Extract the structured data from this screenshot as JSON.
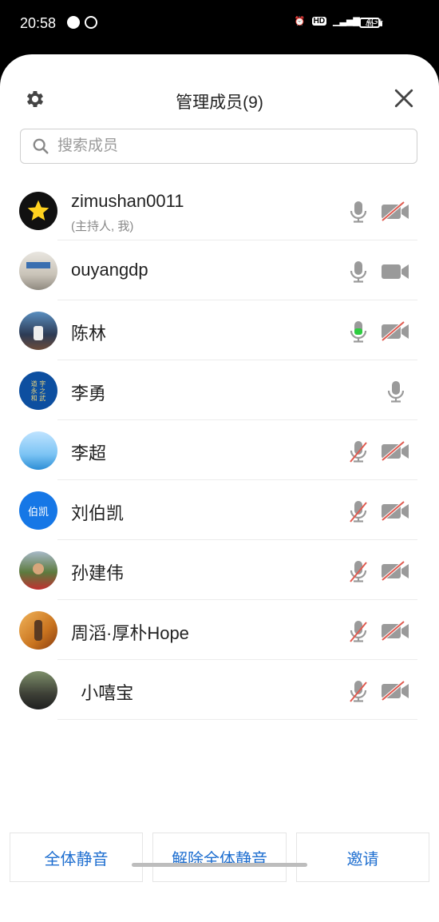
{
  "status_bar": {
    "time": "20:58",
    "hd_label": "HD",
    "signal_label": "4G+",
    "battery": "44"
  },
  "header": {
    "title": "管理成员(9)"
  },
  "search": {
    "placeholder": "搜索成员"
  },
  "members": [
    {
      "name": "zimushan0011",
      "subtitle": "(主持人, 我)",
      "mic": "on",
      "camera": "off",
      "avatar": "star"
    },
    {
      "name": "ouyangdp",
      "subtitle": "",
      "mic": "on",
      "camera": "on",
      "avatar": "photo-room"
    },
    {
      "name": "陈林",
      "subtitle": "",
      "mic": "speaking",
      "camera": "off",
      "avatar": "photo-stage"
    },
    {
      "name": "李勇",
      "subtitle": "",
      "mic": "on",
      "camera": "none",
      "avatar": "calligraphy"
    },
    {
      "name": "李超",
      "subtitle": "",
      "mic": "off",
      "camera": "off",
      "avatar": "sky"
    },
    {
      "name": "刘伯凯",
      "subtitle": "",
      "mic": "off",
      "camera": "off",
      "avatar": "text",
      "avatar_text": "伯凯"
    },
    {
      "name": "孙建伟",
      "subtitle": "",
      "mic": "off",
      "camera": "off",
      "avatar": "photo-person"
    },
    {
      "name": "周滔·厚朴Hope",
      "subtitle": "",
      "mic": "off",
      "camera": "off",
      "avatar": "photo-warm"
    },
    {
      "name": "  小嘻宝",
      "subtitle": "",
      "mic": "off",
      "camera": "off",
      "avatar": "photo-dark"
    }
  ],
  "buttons": {
    "mute_all": "全体静音",
    "unmute_all": "解除全体静音",
    "invite": "邀请"
  },
  "colors": {
    "accent": "#1f6fd0",
    "speaking": "#2ecc40",
    "muted_slash": "#e05a4f",
    "icon_gray": "#9a9a9a"
  }
}
